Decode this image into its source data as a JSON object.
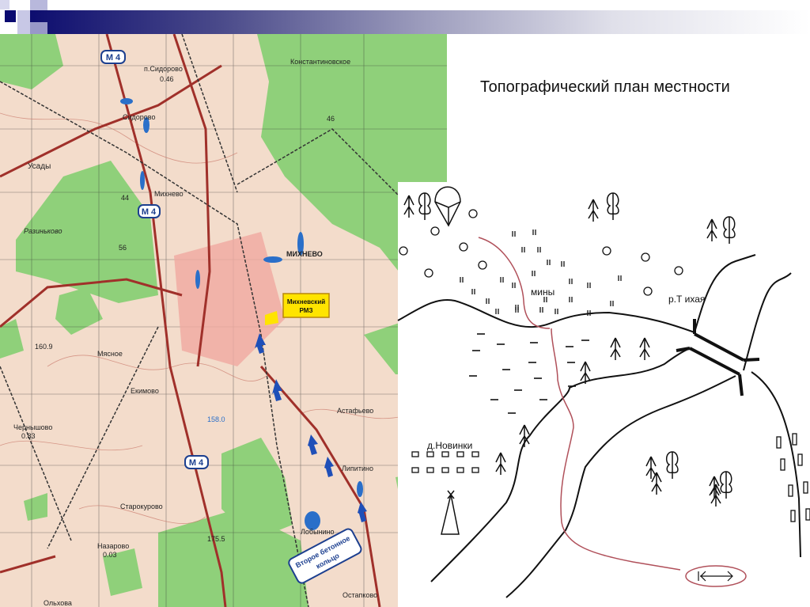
{
  "slide": {
    "title": "Топографический план местности"
  },
  "topo_map": {
    "road_badges": [
      "M 4",
      "M 4",
      "M 4"
    ],
    "place_labels": [
      "п.Сидорово",
      "0.46",
      "Сидорово",
      "Константиновское",
      "Усады",
      "Михнево",
      "Разиньково",
      "МИХНЕВО",
      "160.9",
      "Мясное",
      "Екимово",
      "Чернышово",
      "0.83",
      "Астафьево",
      "Липитино",
      "Старокурово",
      "Назарово",
      "0.03",
      "175.5",
      "Лобынино",
      "Остапково",
      "Ольхова",
      "158.0",
      "46",
      "44",
      "56"
    ],
    "callout_rmz": [
      "Михневский",
      "РМЗ"
    ],
    "callout_ring": [
      "Второе бетонное",
      "кольцо"
    ],
    "colors": {
      "background": "#f3dccb",
      "forest": "#8fd07a",
      "road": "#a0302a",
      "water": "#2a6fc9",
      "arrow": "#1f4fb8",
      "callout": "#ffe400"
    }
  },
  "sketch": {
    "labels": {
      "mines": "мины",
      "river": "р.Т ихая",
      "village": "д.Новинки"
    }
  }
}
